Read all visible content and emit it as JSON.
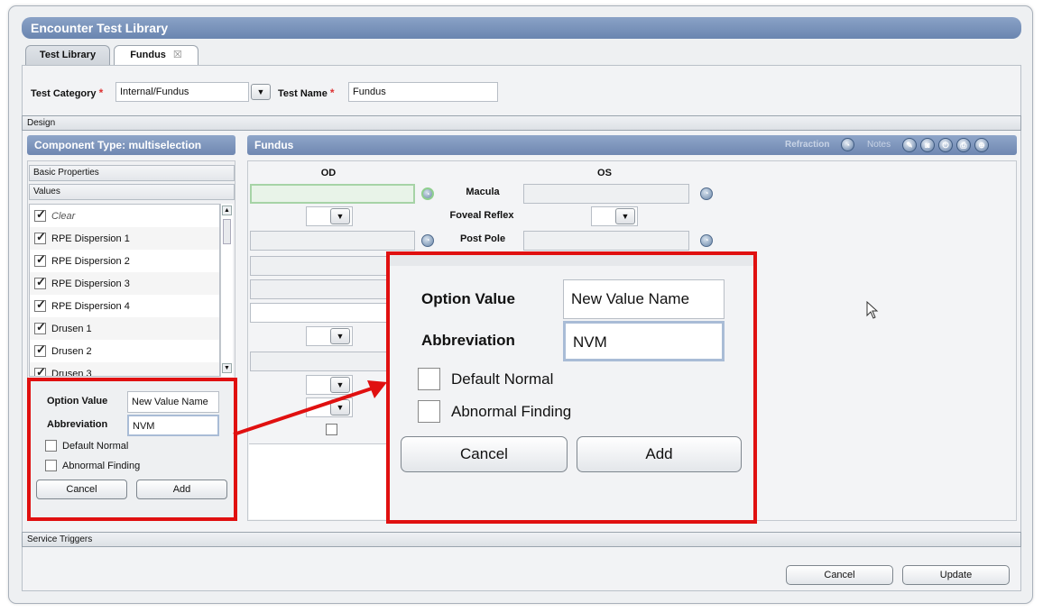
{
  "window": {
    "title": "Encounter Test Library"
  },
  "tabs": [
    {
      "label": "Test Library",
      "active": false
    },
    {
      "label": "Fundus",
      "active": true,
      "close_icon": "close-icon"
    }
  ],
  "form": {
    "test_category_label": "Test Category",
    "test_category_value": "Internal/Fundus",
    "test_name_label": "Test Name",
    "test_name_value": "Fundus",
    "required_marker": "*"
  },
  "sections": {
    "design": "Design",
    "service_triggers": "Service Triggers"
  },
  "left_panel": {
    "title": "Component Type: multiselection",
    "basic_properties": "Basic Properties",
    "values_label": "Values",
    "items": [
      {
        "label": "Clear",
        "checked": true,
        "italic": true
      },
      {
        "label": "RPE Dispersion 1",
        "checked": true
      },
      {
        "label": "RPE Dispersion 2",
        "checked": true
      },
      {
        "label": "RPE Dispersion 3",
        "checked": true
      },
      {
        "label": "RPE Dispersion 4",
        "checked": true
      },
      {
        "label": "Drusen 1",
        "checked": true
      },
      {
        "label": "Drusen 2",
        "checked": true
      },
      {
        "label": "Drusen 3",
        "checked": true
      }
    ]
  },
  "add_form": {
    "option_value_label": "Option Value",
    "option_value": "New Value Name",
    "abbreviation_label": "Abbreviation",
    "abbreviation": "NVM",
    "default_normal": "Default Normal",
    "abnormal_finding": "Abnormal Finding",
    "cancel": "Cancel",
    "add": "Add"
  },
  "fundus_panel": {
    "title": "Fundus",
    "refraction": "Refraction",
    "notes": "Notes",
    "od": "OD",
    "os": "OS",
    "rows": [
      "Macula",
      "Foveal Reflex",
      "Post Pole"
    ]
  },
  "footer": {
    "cancel": "Cancel",
    "update": "Update"
  },
  "colors": {
    "highlight": "#e01010",
    "header_blue": "#6f87b1"
  }
}
